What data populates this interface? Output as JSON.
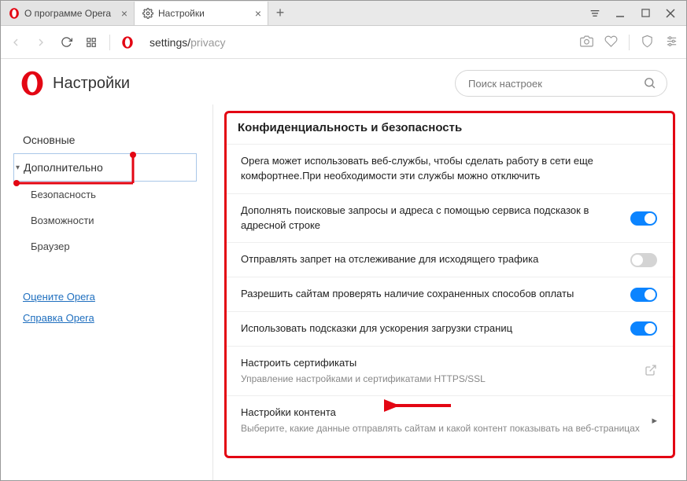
{
  "tabs": [
    {
      "title": "О программе Opera"
    },
    {
      "title": "Настройки"
    }
  ],
  "address": {
    "prefix": "settings/",
    "suffix": "privacy"
  },
  "header": {
    "title": "Настройки"
  },
  "search": {
    "placeholder": "Поиск настроек"
  },
  "sidebar": {
    "items": [
      {
        "label": "Основные"
      },
      {
        "label": "Дополнительно"
      },
      {
        "label": "Безопасность"
      },
      {
        "label": "Возможности"
      },
      {
        "label": "Браузер"
      }
    ],
    "links": [
      {
        "label": "Оцените Opera"
      },
      {
        "label": "Справка Opera"
      }
    ]
  },
  "panel": {
    "title": "Конфиденциальность и безопасность",
    "intro": "Opera может использовать веб-службы, чтобы сделать работу в сети еще комфортнее.При необходимости эти службы можно отключить",
    "rows": [
      {
        "label": "Дополнять поисковые запросы и адреса с помощью сервиса подсказок в адресной строке",
        "toggle": "on"
      },
      {
        "label": "Отправлять запрет на отслеживание для исходящего трафика",
        "toggle": "off"
      },
      {
        "label": "Разрешить сайтам проверять наличие сохраненных способов оплаты",
        "toggle": "on"
      },
      {
        "label": "Использовать подсказки для ускорения загрузки страниц",
        "toggle": "on"
      }
    ],
    "cert": {
      "title": "Настроить сертификаты",
      "sub": "Управление настройками и сертификатами HTTPS/SSL"
    },
    "content_settings": {
      "title": "Настройки контента",
      "sub": "Выберите, какие данные отправлять сайтам и какой контент показывать на веб-страницах"
    }
  }
}
